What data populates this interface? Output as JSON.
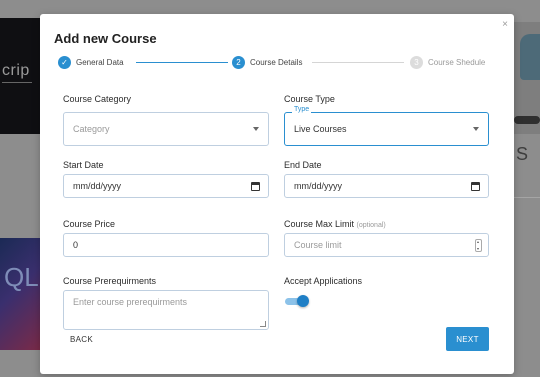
{
  "background": {
    "left_text": "crip",
    "left_image_text": "QL",
    "right_letter": "S"
  },
  "modal": {
    "title": "Add new Course",
    "close": "×",
    "steps": [
      {
        "number": "✓",
        "label": "General Data",
        "state": "done"
      },
      {
        "number": "2",
        "label": "Course Details",
        "state": "active"
      },
      {
        "number": "3",
        "label": "Course Shedule",
        "state": "pending"
      }
    ],
    "fields": {
      "course_category": {
        "label": "Course Category",
        "placeholder": "Category"
      },
      "course_type": {
        "label": "Course Type",
        "floating_label": "Type",
        "value": "Live Courses"
      },
      "start_date": {
        "label": "Start Date",
        "value": "mm/dd/yyyy"
      },
      "end_date": {
        "label": "End Date",
        "value": "mm/dd/yyyy"
      },
      "course_price": {
        "label": "Course Price",
        "value": "0"
      },
      "course_max_limit": {
        "label": "Course Max Limit",
        "optional": "(optional)",
        "placeholder": "Course limit"
      },
      "course_prerequirments": {
        "label": "Course Prerequirments",
        "placeholder": "Enter course prerequirments"
      },
      "accept_applications": {
        "label": "Accept Applications",
        "enabled": true
      }
    },
    "buttons": {
      "back": "BACK",
      "next": "NEXT"
    }
  },
  "colors": {
    "accent": "#2a8fd0",
    "toggle_track": "#8cc2e9"
  }
}
